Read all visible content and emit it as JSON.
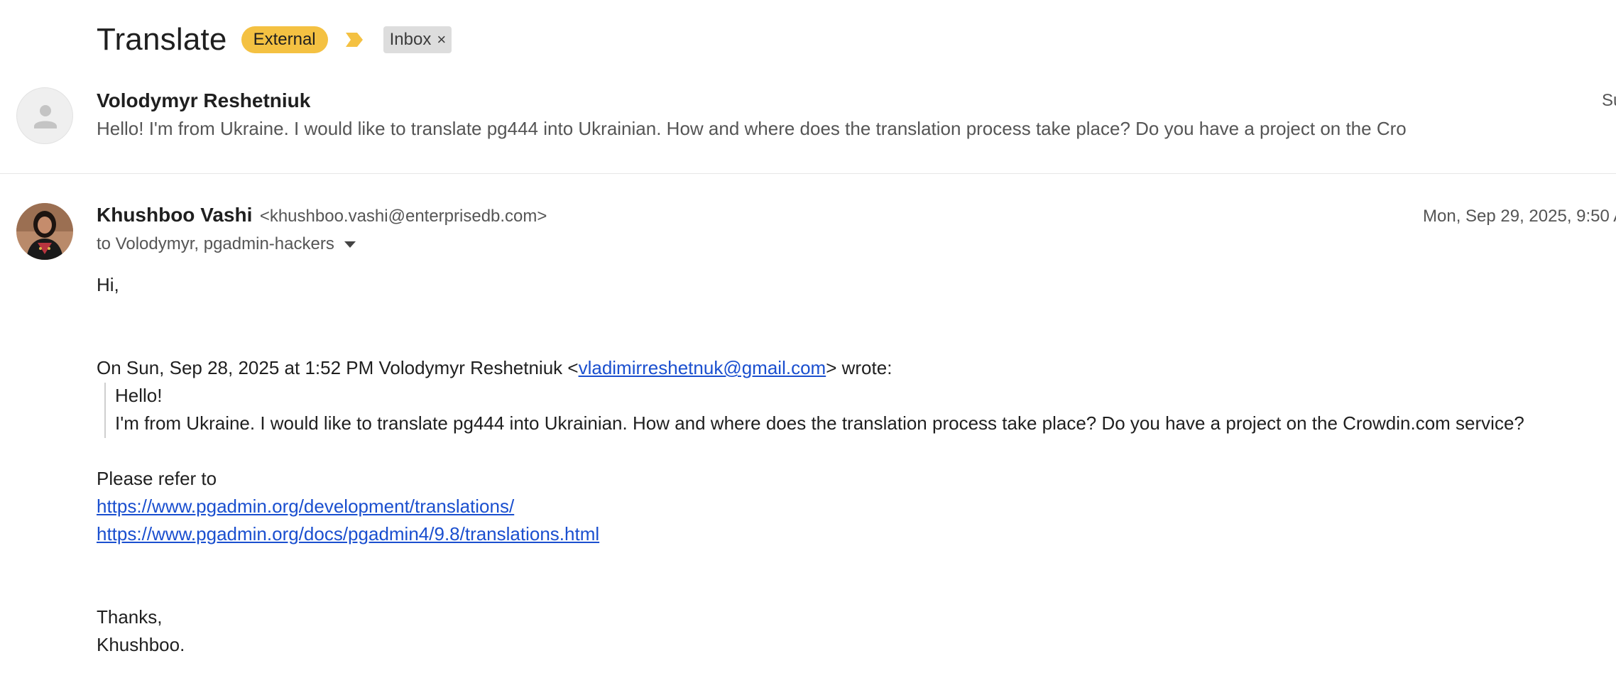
{
  "thread": {
    "subject": "Translate",
    "labels": {
      "external": "External",
      "inbox": "Inbox",
      "remove_symbol": "×"
    },
    "colors": {
      "external_label": "#f4c142",
      "importance_marker": "#f4c142",
      "link": "#1a4fcf"
    }
  },
  "collapsed_message": {
    "sender": "Volodymyr Reshetniuk",
    "snippet": "Hello! I'm from Ukraine. I would like to translate pg444 into Ukrainian. How and where does the translation process take place? Do you have a project on the Cro",
    "date_partial": "Su",
    "avatar_icon": "default-person-icon"
  },
  "expanded_message": {
    "sender_name": "Khushboo Vashi",
    "sender_email": "<khushboo.vashi@enterprisedb.com>",
    "date": "Mon, Sep 29, 2025, 9:50 A",
    "recipients": "to Volodymyr, pgadmin-hackers",
    "avatar_icon": "sender-photo-avatar",
    "body": {
      "greeting": "Hi,",
      "quote_intro_before": "On Sun, Sep 28, 2025 at 1:52 PM Volodymyr Reshetniuk <",
      "quote_intro_email": "vladimirreshetnuk@gmail.com",
      "quote_intro_after": "> wrote:",
      "quoted_line1": "Hello!",
      "quoted_line2": "I'm from Ukraine. I would like to translate pg444 into Ukrainian. How and where does the translation process take place? Do you have a project on the Crowdin.com service?",
      "refer_text": "Please refer to",
      "link1": "https://www.pgadmin.org/development/translations/",
      "link2": "https://www.pgadmin.org/docs/pgadmin4/9.8/translations.html",
      "thanks": "Thanks,",
      "signature": "Khushboo."
    }
  }
}
